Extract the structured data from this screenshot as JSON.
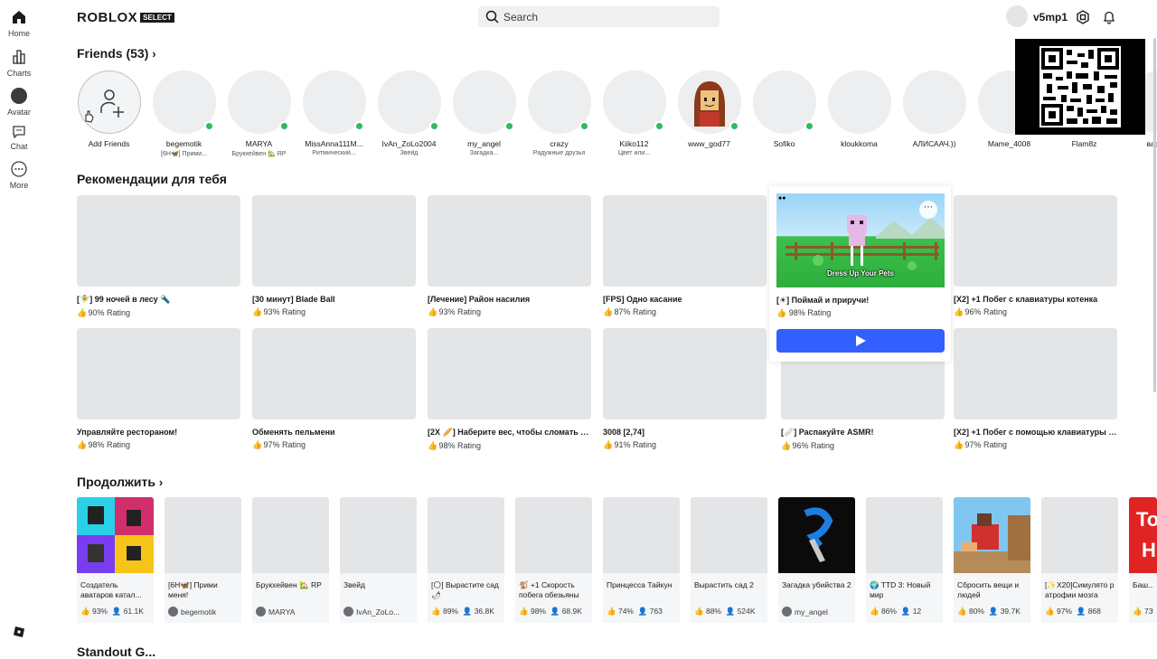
{
  "nav": [
    {
      "label": "Home",
      "icon": "home-icon"
    },
    {
      "label": "Charts",
      "icon": "charts-icon"
    },
    {
      "label": "Avatar",
      "icon": "avatar-icon"
    },
    {
      "label": "Chat",
      "icon": "chat-icon"
    },
    {
      "label": "More",
      "icon": "more-icon"
    }
  ],
  "header": {
    "logo": "ROBLOX",
    "logo_badge": "SELECT",
    "search_placeholder": "Search",
    "username": "v5mp1"
  },
  "friends": {
    "title": "Friends (53)",
    "add_label": "Add Friends",
    "items": [
      {
        "name": "begemotik",
        "status": "[6H🦋] Прими..."
      },
      {
        "name": "MARYA",
        "status": "Брукхейвен 🏡 RP"
      },
      {
        "name": "MissAnna111M...",
        "status": "Ритмический..."
      },
      {
        "name": "IvAn_ZoLo2004",
        "status": "Звейд"
      },
      {
        "name": "my_angel",
        "status": "Загадка..."
      },
      {
        "name": "crazy",
        "status": "Радужные друзья"
      },
      {
        "name": "Kiiko112",
        "status": "Цвет или..."
      },
      {
        "name": "www_god77",
        "status": ""
      },
      {
        "name": "Sofiko",
        "status": ""
      },
      {
        "name": "kloukkoma",
        "status": ""
      },
      {
        "name": "АЛИСААЧ.))",
        "status": ""
      },
      {
        "name": "Mame_4008",
        "status": ""
      },
      {
        "name": "Flam8z",
        "status": ""
      },
      {
        "name": "варвар",
        "status": ""
      }
    ]
  },
  "recommendations": {
    "title": "Рекомендации для тебя",
    "row1": [
      {
        "title": "[🧚] 99 ночей в лесу 🔦",
        "rating": "90% Rating"
      },
      {
        "title": "[30 минут] Blade Ball",
        "rating": "93% Rating"
      },
      {
        "title": "[Лечение] Район насилия",
        "rating": "93% Rating"
      },
      {
        "title": "[FPS] Одно касание",
        "rating": "87% Rating"
      },
      {
        "title": "[☀] Поймай и приручи!",
        "rating": "98% Rating"
      },
      {
        "title": "[X2] +1 Побег с клавиатуры котенка",
        "rating": "96% Rating"
      }
    ],
    "row2": [
      {
        "title": "Управляйте рестораном!",
        "rating": "98% Rating"
      },
      {
        "title": "Обменять пельмени",
        "rating": "97% Rating"
      },
      {
        "title": "[2X 🥖] Наберите вес, чтобы сломать ле...",
        "rating": "98% Rating"
      },
      {
        "title": "3008 [2,74]",
        "rating": "91% Rating"
      },
      {
        "title": "[🩹] Распакуйте ASMR!",
        "rating": "96% Rating"
      },
      {
        "title": "[X2] +1 Побег с помощью клавиатуры с ...",
        "rating": "97% Rating"
      }
    ],
    "hover_caption": "Dress Up Your Pets"
  },
  "continue": {
    "title": "Продолжить",
    "items": [
      {
        "title": "Создатель аватаров катал...",
        "meta_a": "93%",
        "meta_b": "61.1K",
        "type": "stats"
      },
      {
        "title": "[6H🦋] Прими меня!",
        "meta_a": "begemotik",
        "type": "user"
      },
      {
        "title": "Брукхейвен 🏡 RP",
        "meta_a": "MARYA",
        "type": "user"
      },
      {
        "title": "Звейд",
        "meta_a": "IvAn_ZoLo...",
        "type": "user"
      },
      {
        "title": "[🌕] Вырастите сад 🌶",
        "meta_a": "89%",
        "meta_b": "36.8K",
        "type": "stats"
      },
      {
        "title": "🐒 +1 Скорость побега обезьяны",
        "meta_a": "98%",
        "meta_b": "68.9K",
        "type": "stats"
      },
      {
        "title": "Принцесса Тайкун",
        "meta_a": "74%",
        "meta_b": "763",
        "type": "stats"
      },
      {
        "title": "Вырастить сад 2",
        "meta_a": "88%",
        "meta_b": "524K",
        "type": "stats"
      },
      {
        "title": "Загадка убийства 2",
        "meta_a": "my_angel",
        "type": "user"
      },
      {
        "title": "🌍 TTD 3: Новый мир",
        "meta_a": "86%",
        "meta_b": "12",
        "type": "stats"
      },
      {
        "title": "Сбросить вещи и людей",
        "meta_a": "80%",
        "meta_b": "39.7K",
        "type": "stats"
      },
      {
        "title": "[✨X20]Симулято р атрофии мозга",
        "meta_a": "97%",
        "meta_b": "868",
        "type": "stats"
      },
      {
        "title": "Баш...",
        "meta_a": "73%",
        "meta_b": "",
        "type": "stats"
      }
    ]
  },
  "next_section_title": "Standout G..."
}
